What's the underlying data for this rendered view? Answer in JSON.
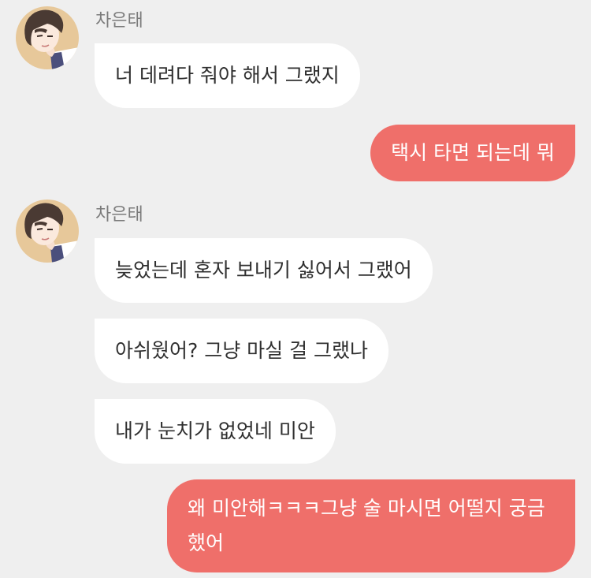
{
  "messages": [
    {
      "sender": "차은태",
      "text": "너 데려다 줘야 해서 그랬지"
    },
    {
      "text": "택시 타면 되는데 뭐"
    },
    {
      "sender": "차은태",
      "text": "늦었는데 혼자 보내기 싫어서 그랬어"
    },
    {
      "text": "아쉬웠어? 그냥 마실 걸 그랬나"
    },
    {
      "text": "내가 눈치가 없었네 미안"
    },
    {
      "text": "왜 미안해ㅋㅋㅋ그냥 술 마시면 어떨지 궁금했어"
    }
  ],
  "colors": {
    "background": "#efefef",
    "incoming_bubble": "#ffffff",
    "outgoing_bubble": "#ef6f6a"
  }
}
